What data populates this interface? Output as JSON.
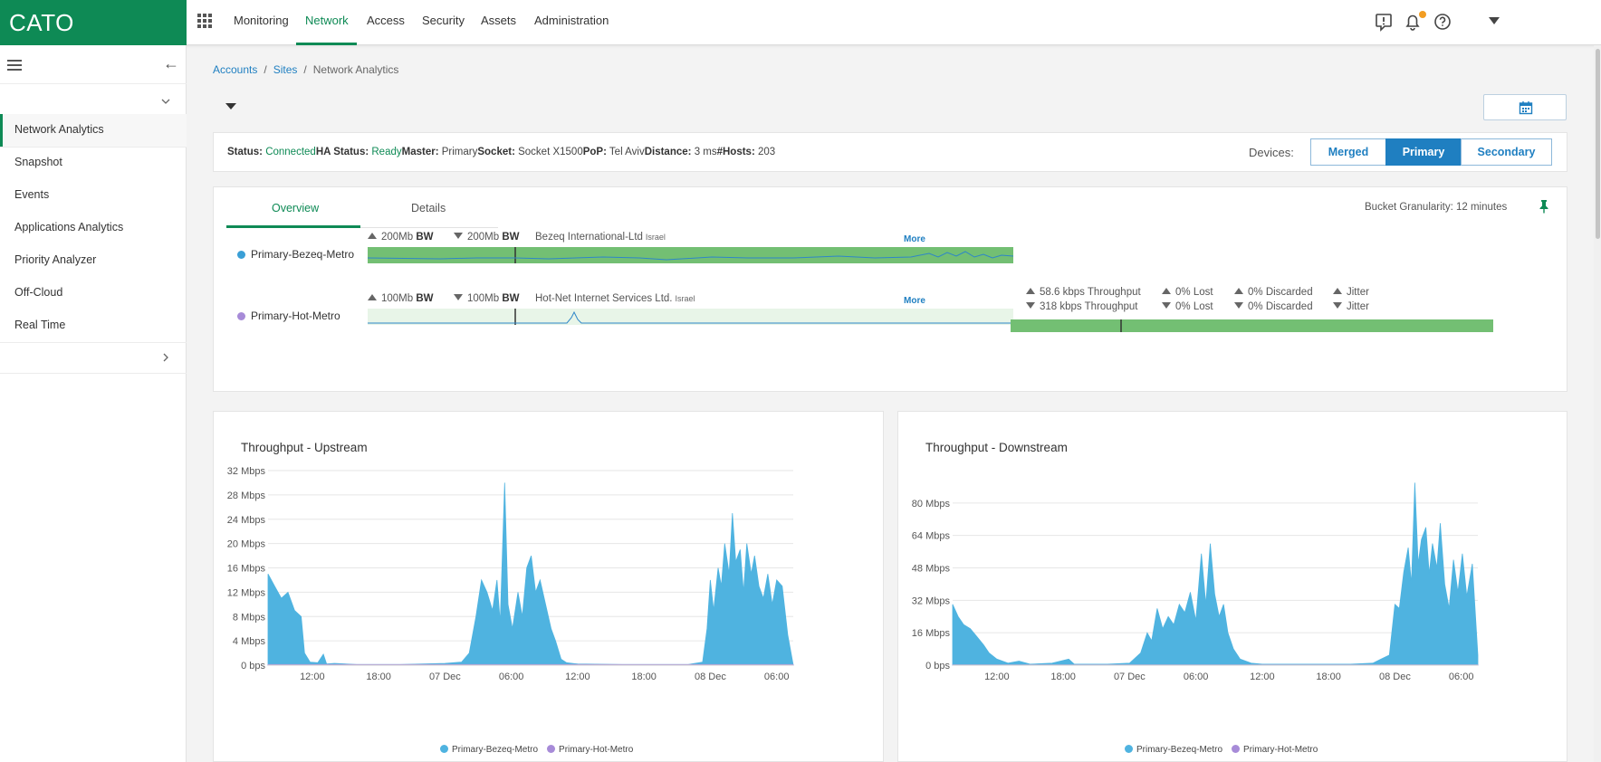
{
  "app": {
    "logo": "CATO"
  },
  "topnav": {
    "items": [
      {
        "label": "Monitoring",
        "active": false
      },
      {
        "label": "Network",
        "active": true
      },
      {
        "label": "Access",
        "active": false
      },
      {
        "label": "Security",
        "active": false
      },
      {
        "label": "Assets",
        "active": false
      },
      {
        "label": "Administration",
        "active": false
      }
    ],
    "icons": [
      "alert-icon",
      "bell-icon",
      "help-icon",
      "user-menu-caret"
    ]
  },
  "sidebar": {
    "items": [
      {
        "label": "Network Analytics",
        "active": true
      },
      {
        "label": "Snapshot"
      },
      {
        "label": "Events"
      },
      {
        "label": "Applications Analytics"
      },
      {
        "label": "Priority Analyzer"
      },
      {
        "label": "Off-Cloud"
      },
      {
        "label": "Real Time"
      }
    ]
  },
  "breadcrumb": {
    "accounts": "Accounts",
    "sites": "Sites",
    "current": "Network Analytics"
  },
  "status": {
    "status_label": "Status:",
    "status_value": "Connected",
    "ha_label": "HA Status:",
    "ha_value": "Ready",
    "master_label": "Master:",
    "master_value": "Primary",
    "socket_label": "Socket:",
    "socket_value": "Socket X1500",
    "pop_label": "PoP:",
    "pop_value": "Tel Aviv",
    "distance_label": "Distance:",
    "distance_value": "3 ms",
    "hosts_label": "#Hosts:",
    "hosts_value": "203"
  },
  "devices": {
    "label": "Devices:",
    "options": [
      "Merged",
      "Primary",
      "Secondary"
    ],
    "selected": "Primary"
  },
  "tabs": {
    "items": [
      "Overview",
      "Details"
    ],
    "selected": "Overview"
  },
  "granularity": "Bucket Granularity: 12 minutes",
  "links": [
    {
      "name": "Primary-Bezeq-Metro",
      "color": "#3a9fd6",
      "up_bw": "200Mb",
      "down_bw": "200Mb",
      "bw_unit": "BW",
      "isp": "Bezeq International-Ltd",
      "country": "Israel",
      "more": "More"
    },
    {
      "name": "Primary-Hot-Metro",
      "color": "#a78bd8",
      "up_bw": "100Mb",
      "down_bw": "100Mb",
      "bw_unit": "BW",
      "isp": "Hot-Net Internet Services Ltd.",
      "country": "Israel",
      "more": "More"
    }
  ],
  "metrics": {
    "up": {
      "throughput": "58.6 kbps Throughput",
      "lost": "0% Lost",
      "discarded": "0% Discarded",
      "jitter": "Jitter"
    },
    "down": {
      "throughput": "318 kbps Throughput",
      "lost": "0% Lost",
      "discarded": "0% Discarded",
      "jitter": "Jitter"
    }
  },
  "colors": {
    "brand": "#0e8a55",
    "link_blue": "#1f7fc1",
    "series_1": "#4fb3e0",
    "series_2": "#a78bd8",
    "bar_green": "#73bf73"
  },
  "chart_data": [
    {
      "type": "area",
      "title": "Throughput - Upstream",
      "ylim": [
        0,
        32
      ],
      "ytick_labels": [
        "32 Mbps",
        "28 Mbps",
        "24 Mbps",
        "20 Mbps",
        "16 Mbps",
        "12 Mbps",
        "8 Mbps",
        "4 Mbps",
        "0 bps"
      ],
      "ytick_values": [
        32,
        28,
        24,
        20,
        16,
        12,
        8,
        4,
        0
      ],
      "xtick_labels": [
        "12:00",
        "18:00",
        "07 Dec",
        "06:00",
        "12:00",
        "18:00",
        "08 Dec",
        "06:00"
      ],
      "xtick_hours": [
        12,
        18,
        24,
        30,
        36,
        42,
        48,
        54
      ],
      "x_range_hours": [
        8,
        55.5
      ],
      "series": [
        {
          "name": "Primary-Bezeq-Metro",
          "color": "#4fb3e0",
          "points": [
            [
              8,
              15
            ],
            [
              8.6,
              13
            ],
            [
              9.2,
              11
            ],
            [
              9.8,
              12
            ],
            [
              10.4,
              9
            ],
            [
              11,
              8
            ],
            [
              11.3,
              2
            ],
            [
              11.8,
              0.5
            ],
            [
              12.5,
              0.4
            ],
            [
              13,
              1.8
            ],
            [
              13.3,
              0.2
            ],
            [
              14,
              0.3
            ],
            [
              16,
              0.1
            ],
            [
              20,
              0.1
            ],
            [
              24,
              0.3
            ],
            [
              25.5,
              0.5
            ],
            [
              26.2,
              2
            ],
            [
              26.8,
              8
            ],
            [
              27.3,
              14
            ],
            [
              27.8,
              12
            ],
            [
              28.3,
              9
            ],
            [
              28.7,
              14
            ],
            [
              29,
              7
            ],
            [
              29.4,
              30
            ],
            [
              29.7,
              10
            ],
            [
              30.1,
              6
            ],
            [
              30.6,
              12
            ],
            [
              31,
              8
            ],
            [
              31.4,
              16
            ],
            [
              31.8,
              18
            ],
            [
              32.2,
              12
            ],
            [
              32.6,
              14
            ],
            [
              33.1,
              10
            ],
            [
              33.6,
              6
            ],
            [
              34,
              4
            ],
            [
              34.5,
              1
            ],
            [
              35,
              0.4
            ],
            [
              36,
              0.2
            ],
            [
              40,
              0.1
            ],
            [
              44,
              0.1
            ],
            [
              46,
              0.1
            ],
            [
              47.3,
              0.5
            ],
            [
              47.7,
              6
            ],
            [
              48,
              14
            ],
            [
              48.3,
              9
            ],
            [
              48.7,
              16
            ],
            [
              49,
              13
            ],
            [
              49.3,
              20
            ],
            [
              49.7,
              15
            ],
            [
              50,
              25
            ],
            [
              50.3,
              17
            ],
            [
              50.7,
              19
            ],
            [
              51,
              12
            ],
            [
              51.3,
              20
            ],
            [
              51.7,
              15
            ],
            [
              52,
              18
            ],
            [
              52.4,
              13
            ],
            [
              52.8,
              11
            ],
            [
              53.2,
              15
            ],
            [
              53.6,
              10
            ],
            [
              54,
              14
            ],
            [
              54.5,
              13
            ],
            [
              55,
              5
            ],
            [
              55.5,
              0
            ]
          ]
        },
        {
          "name": "Primary-Hot-Metro",
          "color": "#a78bd8",
          "points": [
            [
              8,
              0.1
            ],
            [
              55.5,
              0.1
            ]
          ]
        }
      ],
      "legend": [
        "Primary-Bezeq-Metro",
        "Primary-Hot-Metro"
      ]
    },
    {
      "type": "area",
      "title": "Throughput - Downstream",
      "ylim": [
        0,
        96
      ],
      "ytick_labels": [
        "80 Mbps",
        "64 Mbps",
        "48 Mbps",
        "32 Mbps",
        "16 Mbps",
        "0 bps"
      ],
      "ytick_values": [
        80,
        64,
        48,
        32,
        16,
        0
      ],
      "xtick_labels": [
        "12:00",
        "18:00",
        "07 Dec",
        "06:00",
        "12:00",
        "18:00",
        "08 Dec",
        "06:00"
      ],
      "xtick_hours": [
        12,
        18,
        24,
        30,
        36,
        42,
        48,
        54
      ],
      "x_range_hours": [
        8,
        55.5
      ],
      "series": [
        {
          "name": "Primary-Bezeq-Metro",
          "color": "#4fb3e0",
          "points": [
            [
              8,
              30
            ],
            [
              8.5,
              24
            ],
            [
              9,
              20
            ],
            [
              9.6,
              18
            ],
            [
              10.2,
              14
            ],
            [
              10.8,
              10
            ],
            [
              11.3,
              6
            ],
            [
              12,
              3
            ],
            [
              13,
              1
            ],
            [
              14,
              2
            ],
            [
              15,
              0.5
            ],
            [
              17,
              1
            ],
            [
              18.5,
              3
            ],
            [
              19,
              0.5
            ],
            [
              22,
              0.5
            ],
            [
              24,
              1
            ],
            [
              25,
              6
            ],
            [
              25.6,
              16
            ],
            [
              26,
              12
            ],
            [
              26.5,
              28
            ],
            [
              27,
              18
            ],
            [
              27.5,
              24
            ],
            [
              28,
              20
            ],
            [
              28.5,
              30
            ],
            [
              29,
              26
            ],
            [
              29.5,
              36
            ],
            [
              30,
              22
            ],
            [
              30.5,
              55
            ],
            [
              30.9,
              30
            ],
            [
              31.3,
              60
            ],
            [
              31.7,
              35
            ],
            [
              32.1,
              24
            ],
            [
              32.5,
              30
            ],
            [
              32.9,
              16
            ],
            [
              33.4,
              8
            ],
            [
              34,
              3
            ],
            [
              35,
              1
            ],
            [
              36,
              0.5
            ],
            [
              40,
              0.5
            ],
            [
              44,
              0.5
            ],
            [
              46,
              1
            ],
            [
              47.5,
              5
            ],
            [
              48,
              30
            ],
            [
              48.4,
              28
            ],
            [
              48.8,
              46
            ],
            [
              49.2,
              58
            ],
            [
              49.5,
              40
            ],
            [
              49.8,
              90
            ],
            [
              50.1,
              50
            ],
            [
              50.4,
              62
            ],
            [
              50.8,
              68
            ],
            [
              51.1,
              45
            ],
            [
              51.4,
              60
            ],
            [
              51.8,
              48
            ],
            [
              52.1,
              70
            ],
            [
              52.5,
              40
            ],
            [
              52.9,
              28
            ],
            [
              53.3,
              52
            ],
            [
              53.7,
              36
            ],
            [
              54.1,
              55
            ],
            [
              54.5,
              34
            ],
            [
              55,
              50
            ],
            [
              55.5,
              5
            ]
          ]
        },
        {
          "name": "Primary-Hot-Metro",
          "color": "#a78bd8",
          "points": [
            [
              8,
              0.2
            ],
            [
              55.5,
              0.2
            ]
          ]
        }
      ],
      "legend": [
        "Primary-Bezeq-Metro",
        "Primary-Hot-Metro"
      ]
    }
  ]
}
